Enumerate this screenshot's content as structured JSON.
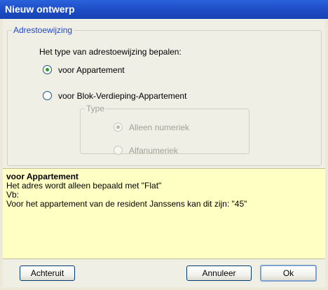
{
  "window": {
    "title": "Nieuw ontwerp"
  },
  "group": {
    "legend": "Adrestoewijzing",
    "prompt": "Het type van adrestoewijzing bepalen:",
    "options": [
      {
        "label": "voor Appartement",
        "selected": true
      },
      {
        "label": "voor Blok-Verdieping-Appartement",
        "selected": false
      }
    ]
  },
  "type_group": {
    "legend": "Type",
    "disabled": true,
    "options": [
      {
        "label": "Alleen numeriek",
        "selected": true
      },
      {
        "label": "Alfanumeriek",
        "selected": false
      }
    ]
  },
  "info": {
    "heading": "voor Appartement",
    "lines": [
      "Het adres wordt alleen bepaald met \"Flat\"",
      "Vb:",
      "Voor het appartement van de resident Janssens kan dit zijn: \"45\""
    ]
  },
  "buttons": {
    "back": "Achteruit",
    "cancel": "Annuleer",
    "ok": "Ok"
  }
}
